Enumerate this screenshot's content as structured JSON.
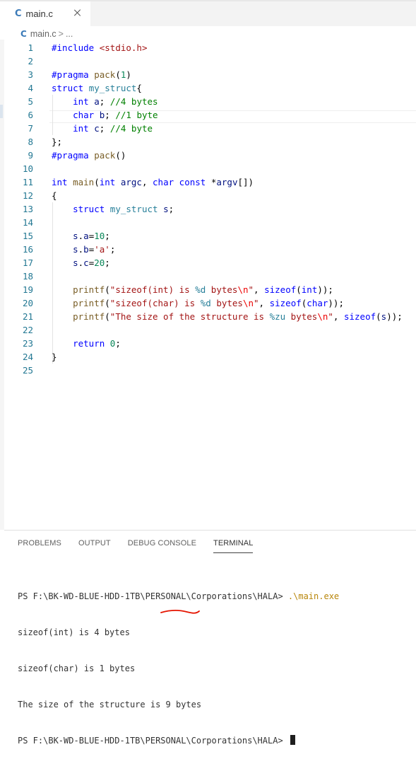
{
  "tab": {
    "icon": "C",
    "filename": "main.c"
  },
  "breadcrumb": {
    "icon": "C",
    "file": "main.c",
    "separator": ">",
    "more": "..."
  },
  "editor": {
    "line_numbers": [
      "1",
      "2",
      "3",
      "4",
      "5",
      "6",
      "7",
      "8",
      "9",
      "10",
      "11",
      "12",
      "13",
      "14",
      "15",
      "16",
      "17",
      "18",
      "19",
      "20",
      "21",
      "22",
      "23",
      "24",
      "25"
    ],
    "lines": [
      "#include <stdio.h>",
      "",
      "#pragma pack(1)",
      "struct my_struct{",
      "    int a; //4 bytes",
      "    char b; //1 byte",
      "    int c; //4 byte",
      "};",
      "#pragma pack()",
      "",
      "int main(int argc, char const *argv[])",
      "{",
      "    struct my_struct s;",
      "",
      "    s.a=10;",
      "    s.b='a';",
      "    s.c=20;",
      "",
      "    printf(\"sizeof(int) is %d bytes\\n\", sizeof(int));",
      "    printf(\"sizeof(char) is %d bytes\\n\", sizeof(char));",
      "    printf(\"The size of the structure is %zu bytes\\n\", sizeof(s));",
      "",
      "    return 0;",
      "}",
      ""
    ]
  },
  "panel": {
    "tabs": [
      "PROBLEMS",
      "OUTPUT",
      "DEBUG CONSOLE",
      "TERMINAL"
    ],
    "active_tab": "TERMINAL"
  },
  "terminal": {
    "prompt1": "PS F:\\BK-WD-BLUE-HDD-1TB\\PERSONAL\\Corporations\\HALA> ",
    "command": ".\\main.exe",
    "out1": "sizeof(int) is 4 bytes",
    "out2": "sizeof(char) is 1 bytes",
    "out3_prefix": "The size of the structure is ",
    "out3_value": "9 bytes",
    "prompt2": "PS F:\\BK-WD-BLUE-HDD-1TB\\PERSONAL\\Corporations\\HALA> "
  },
  "colors": {
    "keyword": "#0000ff",
    "string": "#a31515",
    "comment": "#008000",
    "number": "#098658",
    "line_number": "#237893",
    "c_icon": "#3a7ab8",
    "annotation_underline": "#e51400"
  }
}
